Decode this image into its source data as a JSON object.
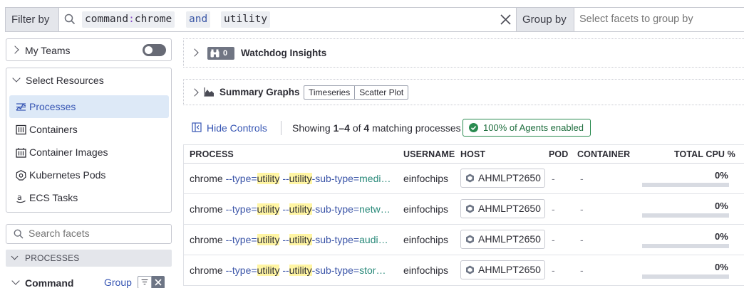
{
  "search": {
    "filter_label": "Filter by",
    "tokens": [
      {
        "key": "command",
        "colon": ":",
        "value": "chrome"
      },
      {
        "op": "and"
      },
      {
        "text": "utility"
      }
    ],
    "group_label": "Group by",
    "group_placeholder": "Select facets to group by"
  },
  "sidebar": {
    "my_teams": "My Teams",
    "my_teams_enabled": false,
    "select_resources": "Select Resources",
    "resources": [
      {
        "label": "Processes",
        "icon": "processes-icon",
        "active": true
      },
      {
        "label": "Containers",
        "icon": "containers-icon",
        "active": false
      },
      {
        "label": "Container Images",
        "icon": "container-images-icon",
        "active": false
      },
      {
        "label": "Kubernetes Pods",
        "icon": "kubernetes-icon",
        "active": false
      },
      {
        "label": "ECS Tasks",
        "icon": "aws-icon",
        "active": false
      }
    ],
    "facet_search_placeholder": "Search facets",
    "section_header": "PROCESSES",
    "facet_command": "Command",
    "facet_group": "Group"
  },
  "watchdog": {
    "count": "0",
    "title": "Watchdog Insights"
  },
  "summary": {
    "title": "Summary Graphs",
    "views": [
      "Timeseries",
      "Scatter Plot"
    ]
  },
  "controls": {
    "hide_controls": "Hide Controls",
    "showing_prefix": "Showing ",
    "showing_range": "1–4",
    "showing_of": " of ",
    "showing_total": "4",
    "showing_suffix": " matching processes",
    "agents_badge": "100% of Agents enabled"
  },
  "table": {
    "columns": {
      "process": "PROCESS",
      "username": "USERNAME",
      "host": "HOST",
      "pod": "POD",
      "container": "CONTAINER",
      "cpu": "TOTAL CPU %"
    },
    "rows": [
      {
        "exe": "chrome",
        "subtype": "medi…",
        "user": "einfochips",
        "host": "AHMLPT2650",
        "pod": "-",
        "container": "-",
        "cpu": "0%",
        "cpu_fraction": 0.0
      },
      {
        "exe": "chrome",
        "subtype": "netw…",
        "user": "einfochips",
        "host": "AHMLPT2650",
        "pod": "-",
        "container": "-",
        "cpu": "0%",
        "cpu_fraction": 0.0
      },
      {
        "exe": "chrome",
        "subtype": "audi…",
        "user": "einfochips",
        "host": "AHMLPT2650",
        "pod": "-",
        "container": "-",
        "cpu": "0%",
        "cpu_fraction": 0.0
      },
      {
        "exe": "chrome",
        "subtype": "stor…",
        "user": "einfochips",
        "host": "AHMLPT2650",
        "pod": "-",
        "container": "-",
        "cpu": "0%",
        "cpu_fraction": 0.0
      }
    ],
    "arg_type": "--type=",
    "arg_hl": "utility",
    "arg_sub_pre": "--",
    "arg_sub_post": "-sub-type="
  },
  "colors": {
    "accent": "#3655b3",
    "highlight": "#fff5a3",
    "success": "#2a8b50",
    "cpu_fill": "#3c8cd9"
  }
}
